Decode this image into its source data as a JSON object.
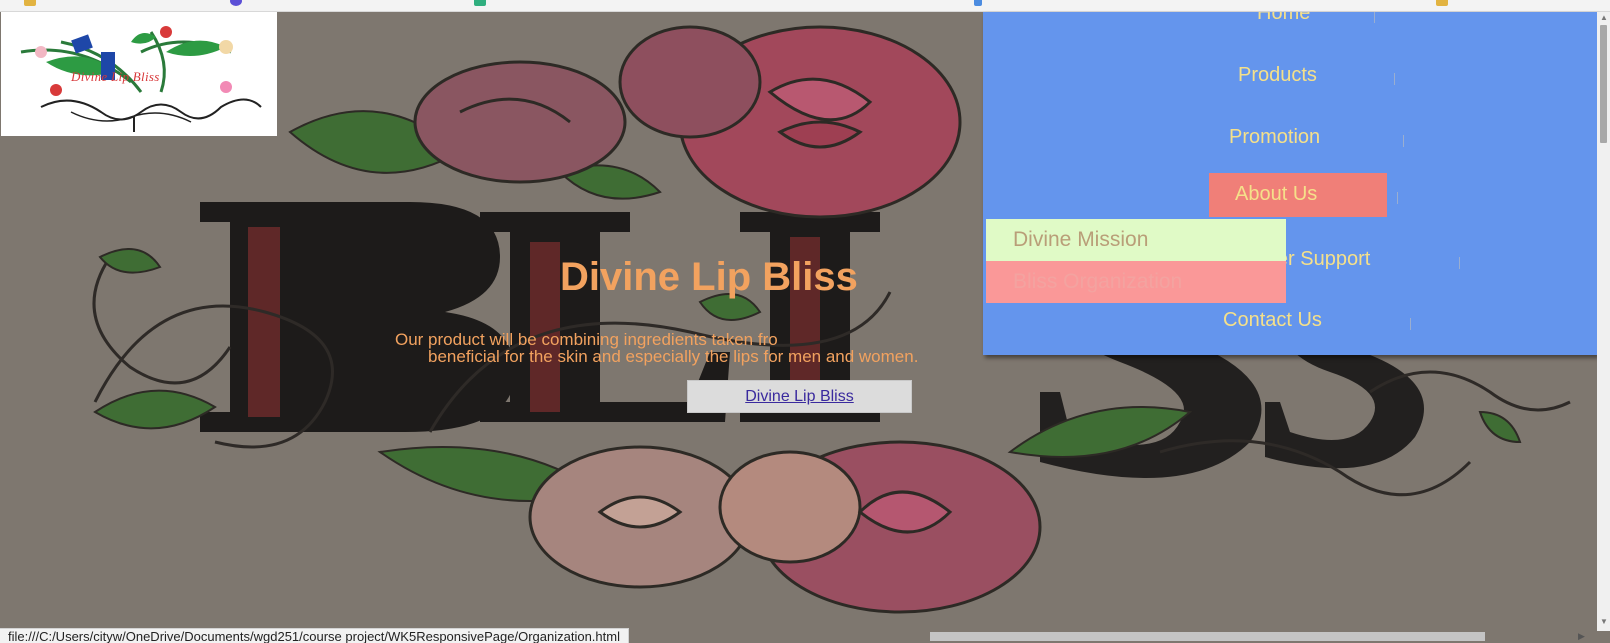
{
  "logo": {
    "text": "Divine Lip Bliss"
  },
  "hero": {
    "title": "Divine Lip Bliss",
    "subtitle_line1": "Our product will be combining ingredients taken fro",
    "subtitle_line2": "beneficial for the skin and especially the lips for men and women.",
    "button_label": "Divine Lip Bliss"
  },
  "nav": {
    "items": [
      {
        "label": "Home"
      },
      {
        "label": "Products"
      },
      {
        "label": "Promotion"
      },
      {
        "label": "About Us"
      },
      {
        "label": "Customer Support"
      },
      {
        "label": "Contact Us"
      }
    ],
    "separator": "|"
  },
  "dropdown": {
    "items": [
      {
        "label": "Divine Mission"
      },
      {
        "label": "Bliss Organization"
      }
    ]
  },
  "status_bar": {
    "url": "file:///C:/Users/cityw/OneDrive/Documents/wgd251/course project/WK5ResponsivePage/Organization.html"
  },
  "colors": {
    "nav_bg": "#6495ed",
    "nav_text": "#f5e08a",
    "active_item": "#f07f78",
    "dropdown_mission_bg": "#e0fac6",
    "dropdown_org_bg": "#fa9898",
    "hero_text": "#f2a25f"
  }
}
